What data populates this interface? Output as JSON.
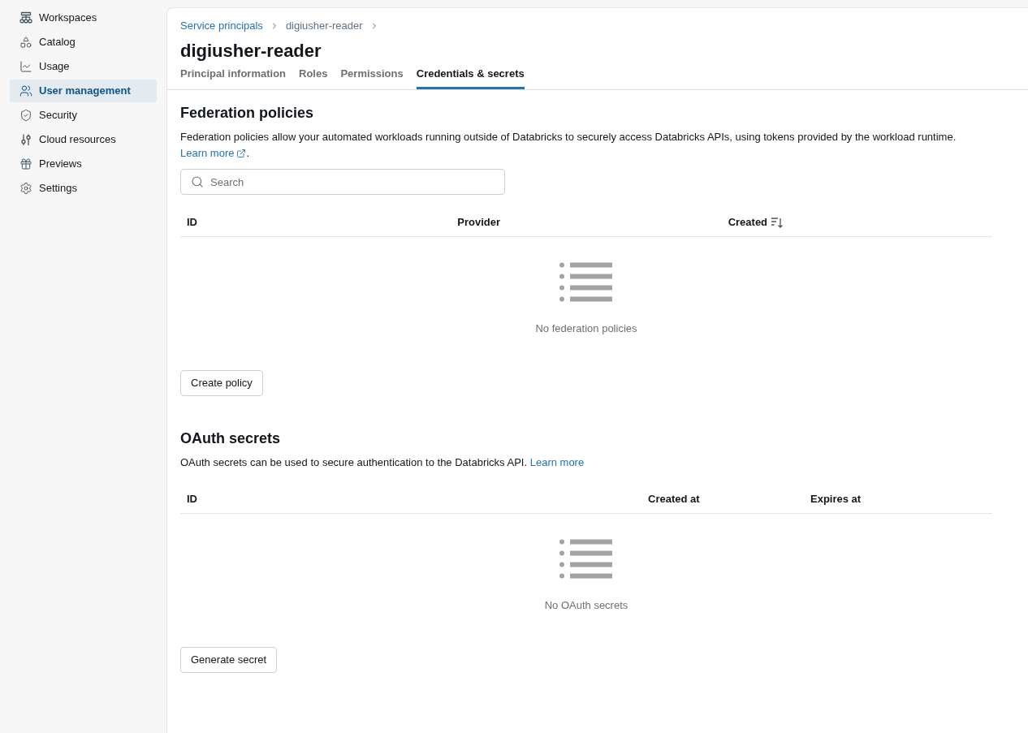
{
  "sidebar": {
    "items": [
      {
        "label": "Workspaces",
        "selected": false
      },
      {
        "label": "Catalog",
        "selected": false
      },
      {
        "label": "Usage",
        "selected": false
      },
      {
        "label": "User management",
        "selected": true
      },
      {
        "label": "Security",
        "selected": false
      },
      {
        "label": "Cloud resources",
        "selected": false
      },
      {
        "label": "Previews",
        "selected": false
      },
      {
        "label": "Settings",
        "selected": false
      }
    ]
  },
  "breadcrumb": [
    {
      "label": "Service principals",
      "kind": "link"
    },
    {
      "label": "digiusher-reader",
      "kind": "current"
    }
  ],
  "title": "digiusher-reader",
  "tabs": [
    {
      "label": "Principal information",
      "selected": false
    },
    {
      "label": "Roles",
      "selected": false
    },
    {
      "label": "Permissions",
      "selected": false
    },
    {
      "label": "Credentials & secrets",
      "selected": true
    }
  ],
  "federation_policies": {
    "heading": "Federation policies",
    "description": {
      "text": "Federation policies allow your automated workloads running outside of Databricks to securely access Databricks APIs, using tokens provided by the workload runtime.",
      "link": {
        "label": "Learn more",
        "external": true
      },
      "suffix": "."
    },
    "search": {
      "placeholder": "Search"
    },
    "table": {
      "columns": [
        {
          "label": "ID",
          "sorted": false
        },
        {
          "label": "Provider",
          "sorted": false
        },
        {
          "label": "Created",
          "sorted": true
        }
      ]
    },
    "empty_message": "No federation policies",
    "button": "Create policy"
  },
  "oauth_secrets": {
    "heading": "OAuth secrets",
    "description": {
      "text": "OAuth secrets can be used to secure authentication to the Databricks API.",
      "link": {
        "label": "Learn more",
        "external": false
      }
    },
    "table": {
      "columns": [
        {
          "label": "ID",
          "sorted": false
        },
        {
          "label": "Created at",
          "sorted": false
        },
        {
          "label": "Expires at",
          "sorted": false
        }
      ]
    },
    "empty_message": "No OAuth secrets",
    "button": "Generate secret"
  }
}
